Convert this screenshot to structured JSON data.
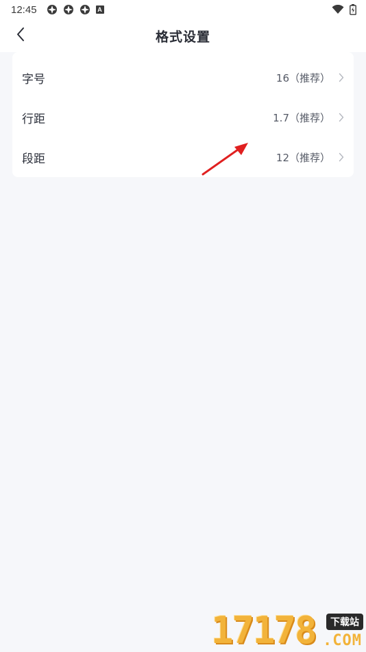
{
  "status_bar": {
    "time": "12:45",
    "left_icons": [
      "notification-icon",
      "notification-icon",
      "notification-icon",
      "a-badge-icon"
    ],
    "a_badge": "A",
    "right_icons": [
      "wifi-icon",
      "battery-icon"
    ]
  },
  "header": {
    "title": "格式设置",
    "back_icon": "chevron-left-icon"
  },
  "settings": {
    "items": [
      {
        "label": "字号",
        "value": "16（推荐）"
      },
      {
        "label": "行距",
        "value": "1.7（推荐）"
      },
      {
        "label": "段距",
        "value": "12（推荐）"
      }
    ]
  },
  "annotation": {
    "icon": "red-arrow-icon",
    "color": "#e02020"
  },
  "watermark": {
    "digits": "17178",
    "tag": "下载站",
    "domain": ".COM"
  },
  "colors": {
    "background": "#f6f7fa",
    "card": "#ffffff",
    "text": "#2b2f3a",
    "value_text": "#555a66",
    "chevron": "#b5b8c0"
  }
}
